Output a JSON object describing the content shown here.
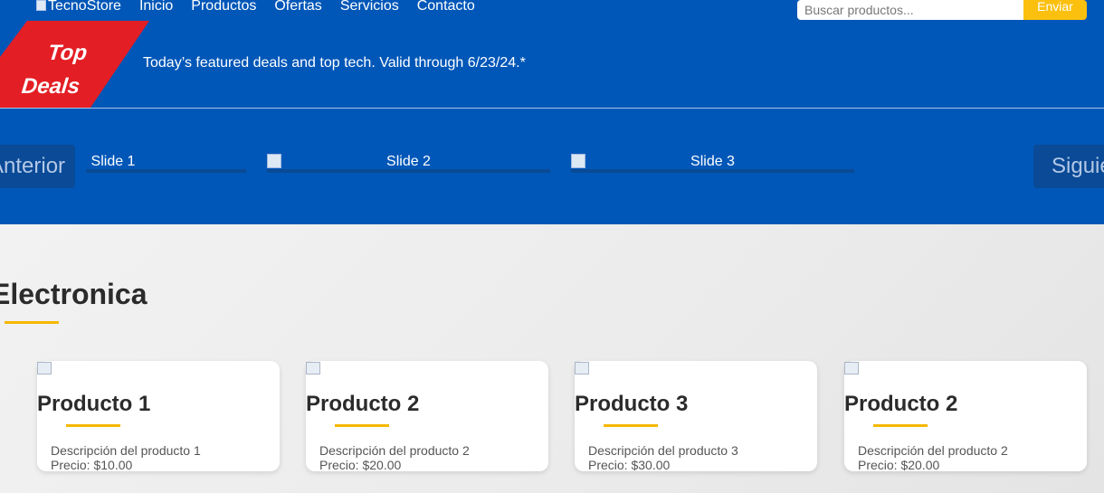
{
  "header": {
    "logo_alt": "TecnoStore",
    "nav": [
      "Inicio",
      "Productos",
      "Ofertas",
      "Servicios",
      "Contacto"
    ],
    "search": {
      "placeholder": "Buscar productos...",
      "button": "Enviar"
    },
    "badge": {
      "line1": "Top",
      "line2": "Deals"
    },
    "promo_text": "Today’s featured deals and top tech. Valid through 6/23/24.*"
  },
  "carousel": {
    "prev_label": "Anterior",
    "next_label": "Siguiente",
    "slides": [
      "Slide 1",
      "Slide 2",
      "Slide 3"
    ]
  },
  "section": {
    "title": "Electronica",
    "products": [
      {
        "name": "Producto 1",
        "description": "Descripción del producto 1",
        "price": "Precio: $10.00"
      },
      {
        "name": "Producto 2",
        "description": "Descripción del producto 2",
        "price": "Precio: $20.00"
      },
      {
        "name": "Producto 3",
        "description": "Descripción del producto 3",
        "price": "Precio: $30.00"
      },
      {
        "name": "Producto 2",
        "description": "Descripción del producto 2",
        "price": "Precio: $20.00"
      }
    ]
  },
  "colors": {
    "header_bg": "#0057b8",
    "accent": "#f5b800",
    "badge_red": "#e31e24"
  }
}
